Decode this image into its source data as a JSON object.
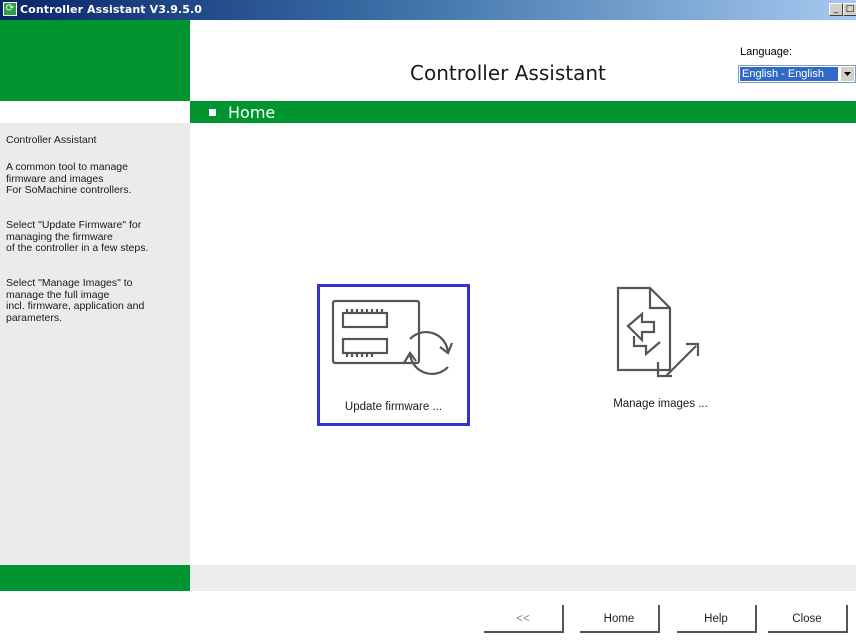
{
  "window": {
    "title": "Controller Assistant V3.9.5.0",
    "controls": {
      "minimize": "_",
      "maximize": "□"
    }
  },
  "header": {
    "app_title": "Controller Assistant",
    "language_label": "Language:",
    "language_value": "English - English"
  },
  "section": {
    "title": "Home"
  },
  "sidebar": {
    "paragraphs": [
      "Controller Assistant",
      "A common tool to manage\nfirmware and images\nFor SoMachine controllers.",
      "Select \"Update Firmware\" for\nmanaging the firmware\nof the controller in a few steps.",
      "Select \"Manage Images\" to\nmanage the full image\nincl. firmware, application and\nparameters."
    ]
  },
  "tiles": [
    {
      "label": "Update firmware ...",
      "icon": "controller-refresh-icon",
      "selected": true
    },
    {
      "label": "Manage images ...",
      "icon": "document-transfer-icon",
      "selected": false
    }
  ],
  "footer": {
    "back_label": "<<",
    "home_label": "Home",
    "help_label": "Help",
    "close_label": "Close"
  },
  "colors": {
    "brand_green": "#009530",
    "selection_border": "#3333cc",
    "sidebar_bg": "#ebebeb"
  }
}
